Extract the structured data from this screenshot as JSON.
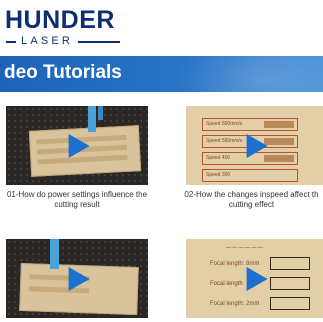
{
  "brand": {
    "name": "HUNDER",
    "sub": "LASER"
  },
  "page_title": "deo Tutorials",
  "videos": [
    {
      "caption_line1": "01-How do power settings influence the",
      "caption_line2": "cutting result"
    },
    {
      "caption_line1": "02-How the changes inspeed affect th",
      "caption_line2": "cutting effect"
    },
    {
      "caption_line1": "",
      "caption_line2": ""
    },
    {
      "caption_line1": "",
      "caption_line2": ""
    }
  ],
  "thumb2_labels": [
    "Speed 600mm/s",
    "Speed 500mm/s",
    "Speed 400",
    "Speed 300"
  ],
  "thumb4_labels": [
    "Focal length: 8mm",
    "Focal length",
    "Focal length: 2mm"
  ],
  "colors": {
    "brand_navy": "#0d2f72",
    "title_bar": "#2a74c7",
    "play_icon": "#1d6fd0"
  }
}
